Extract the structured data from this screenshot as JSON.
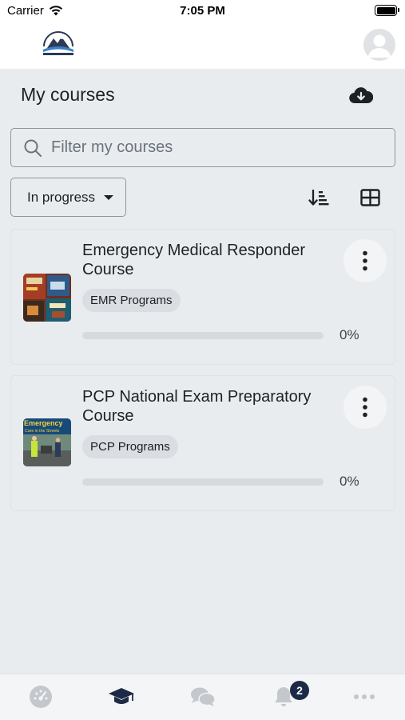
{
  "status_bar": {
    "carrier": "Carrier",
    "time": "7:05 PM"
  },
  "header": {
    "logo": "site-logo",
    "avatar": "user-avatar"
  },
  "page": {
    "title": "My courses",
    "download_icon": "cloud-download-icon"
  },
  "search": {
    "placeholder": "Filter my courses",
    "value": ""
  },
  "filter": {
    "selected": "In progress"
  },
  "toolbar": {
    "sort_icon": "sort-icon",
    "layout_icon": "grid-icon"
  },
  "courses": [
    {
      "title": "Emergency Medical Responder Course",
      "category": "EMR Programs",
      "progress": 0,
      "progress_text": "0%"
    },
    {
      "title": "PCP National Exam Preparatory Course",
      "category": "PCP Programs",
      "progress": 0,
      "progress_text": "0%",
      "thumb_text_1": "Emergency",
      "thumb_text_2": "Care in the Streets"
    }
  ],
  "tabs": [
    {
      "name": "dashboard",
      "icon": "gauge-icon"
    },
    {
      "name": "my-courses",
      "icon": "graduation-cap-icon",
      "active": true
    },
    {
      "name": "messages",
      "icon": "chat-bubbles-icon"
    },
    {
      "name": "notifications",
      "icon": "bell-icon",
      "badge": "2"
    },
    {
      "name": "more",
      "icon": "more-dots-icon"
    }
  ],
  "colors": {
    "accent": "#0f6cbf",
    "active_tab": "#1c2a46",
    "inactive_tab": "#c4c8cd",
    "background": "#e9ecef"
  }
}
